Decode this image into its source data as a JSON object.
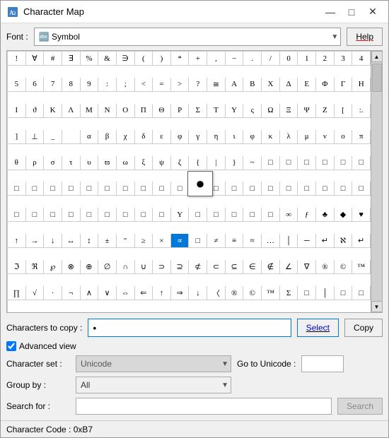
{
  "window": {
    "title": "Character Map",
    "icon": "🗺"
  },
  "titlebar": {
    "minimize": "—",
    "maximize": "□",
    "close": "✕"
  },
  "font": {
    "label": "Font :",
    "value": "Symbol",
    "icon": "🔤"
  },
  "help_button": "Help",
  "grid": {
    "rows": [
      [
        "!",
        "∀",
        "#",
        "∃",
        "%",
        "&",
        "∋",
        "(",
        ")",
        "*",
        "+",
        ",",
        "−",
        ".",
        "/",
        "0",
        "1",
        "2",
        "3",
        "4"
      ],
      [
        "5",
        "6",
        "7",
        "8",
        "9",
        ":",
        ";",
        "<",
        "=",
        ">",
        "?",
        "≅",
        "Α",
        "Β",
        "Χ",
        "Δ",
        "Ε",
        "Φ",
        "Γ",
        "Η"
      ],
      [
        "Ι",
        "ϑ",
        "Κ",
        "Λ",
        "Μ",
        "Ν",
        "Ο",
        "Π",
        "Θ",
        "Ρ",
        "Σ",
        "Τ",
        "Υ",
        "ς",
        "Ω",
        "Ξ",
        "Ψ",
        "Ζ",
        "[",
        ":."
      ],
      [
        "]",
        "⊥",
        "_",
        "",
        "α",
        "β",
        "χ",
        "δ",
        "ε",
        "φ",
        "γ",
        "η",
        "ι",
        "φ",
        "κ",
        "λ",
        "μ",
        "ν",
        "ο",
        "π"
      ],
      [
        "θ",
        "ρ",
        "σ",
        "τ",
        "υ",
        "ϖ",
        "ω",
        "ξ",
        "ψ",
        "ζ",
        "{",
        "|",
        "}",
        "~",
        "□",
        "□",
        "□",
        "□",
        "□",
        "□"
      ],
      [
        "□",
        "□",
        "□",
        "□",
        "□",
        "□",
        "□",
        "□",
        "□",
        "□",
        "□",
        "□",
        "□",
        "□",
        "□",
        "□",
        "□",
        "□",
        "□",
        "□"
      ],
      [
        "□",
        "□",
        "□",
        "□",
        "□",
        "□",
        "□",
        "□",
        "□",
        "Υ",
        "□",
        "□",
        "□",
        "□",
        "□",
        "∞",
        "ƒ",
        "♣",
        "◆",
        "♥"
      ],
      [
        "↑",
        "→",
        "↓",
        "↔",
        "↕",
        "±",
        "″",
        "≥",
        "×",
        "∝",
        "□",
        "≠",
        "≡",
        "≈",
        "…",
        "│",
        "─",
        "↵",
        "ℵ",
        "↵"
      ],
      [
        "ℑ",
        "ℜ",
        "℘",
        "⊗",
        "⊕",
        "∅",
        "∩",
        "∪",
        "⊃",
        "⊇",
        "⊄",
        "⊂",
        "⊆",
        "∈",
        "∉",
        "∠",
        "∇",
        "®",
        "©",
        "™"
      ],
      [
        "∏",
        "√",
        "·",
        "¬",
        "∧",
        "∨",
        "⇔",
        "⇐",
        "↑",
        "⇒",
        "↓",
        "〈",
        "®",
        "©",
        "™",
        "Σ",
        "□",
        "│",
        "□",
        "□"
      ]
    ],
    "selected_cell": {
      "row": 7,
      "col": 9
    },
    "enlarged_cell": {
      "row": 7,
      "col": 9,
      "char": "●"
    }
  },
  "chars_to_copy": {
    "label": "Characters to copy :",
    "value": "•"
  },
  "buttons": {
    "select": "Select",
    "copy": "Copy"
  },
  "advanced_view": {
    "label": "Advanced view",
    "checked": true
  },
  "character_set": {
    "label": "Character set :",
    "value": "Unicode",
    "options": [
      "Unicode"
    ]
  },
  "go_to_unicode": {
    "label": "Go to Unicode :",
    "value": ""
  },
  "group_by": {
    "label": "Group by :",
    "value": "All",
    "options": [
      "All"
    ]
  },
  "search_for": {
    "label": "Search for :",
    "placeholder": "",
    "button": "Search"
  },
  "status_bar": {
    "text": "Character Code : 0xB7"
  }
}
